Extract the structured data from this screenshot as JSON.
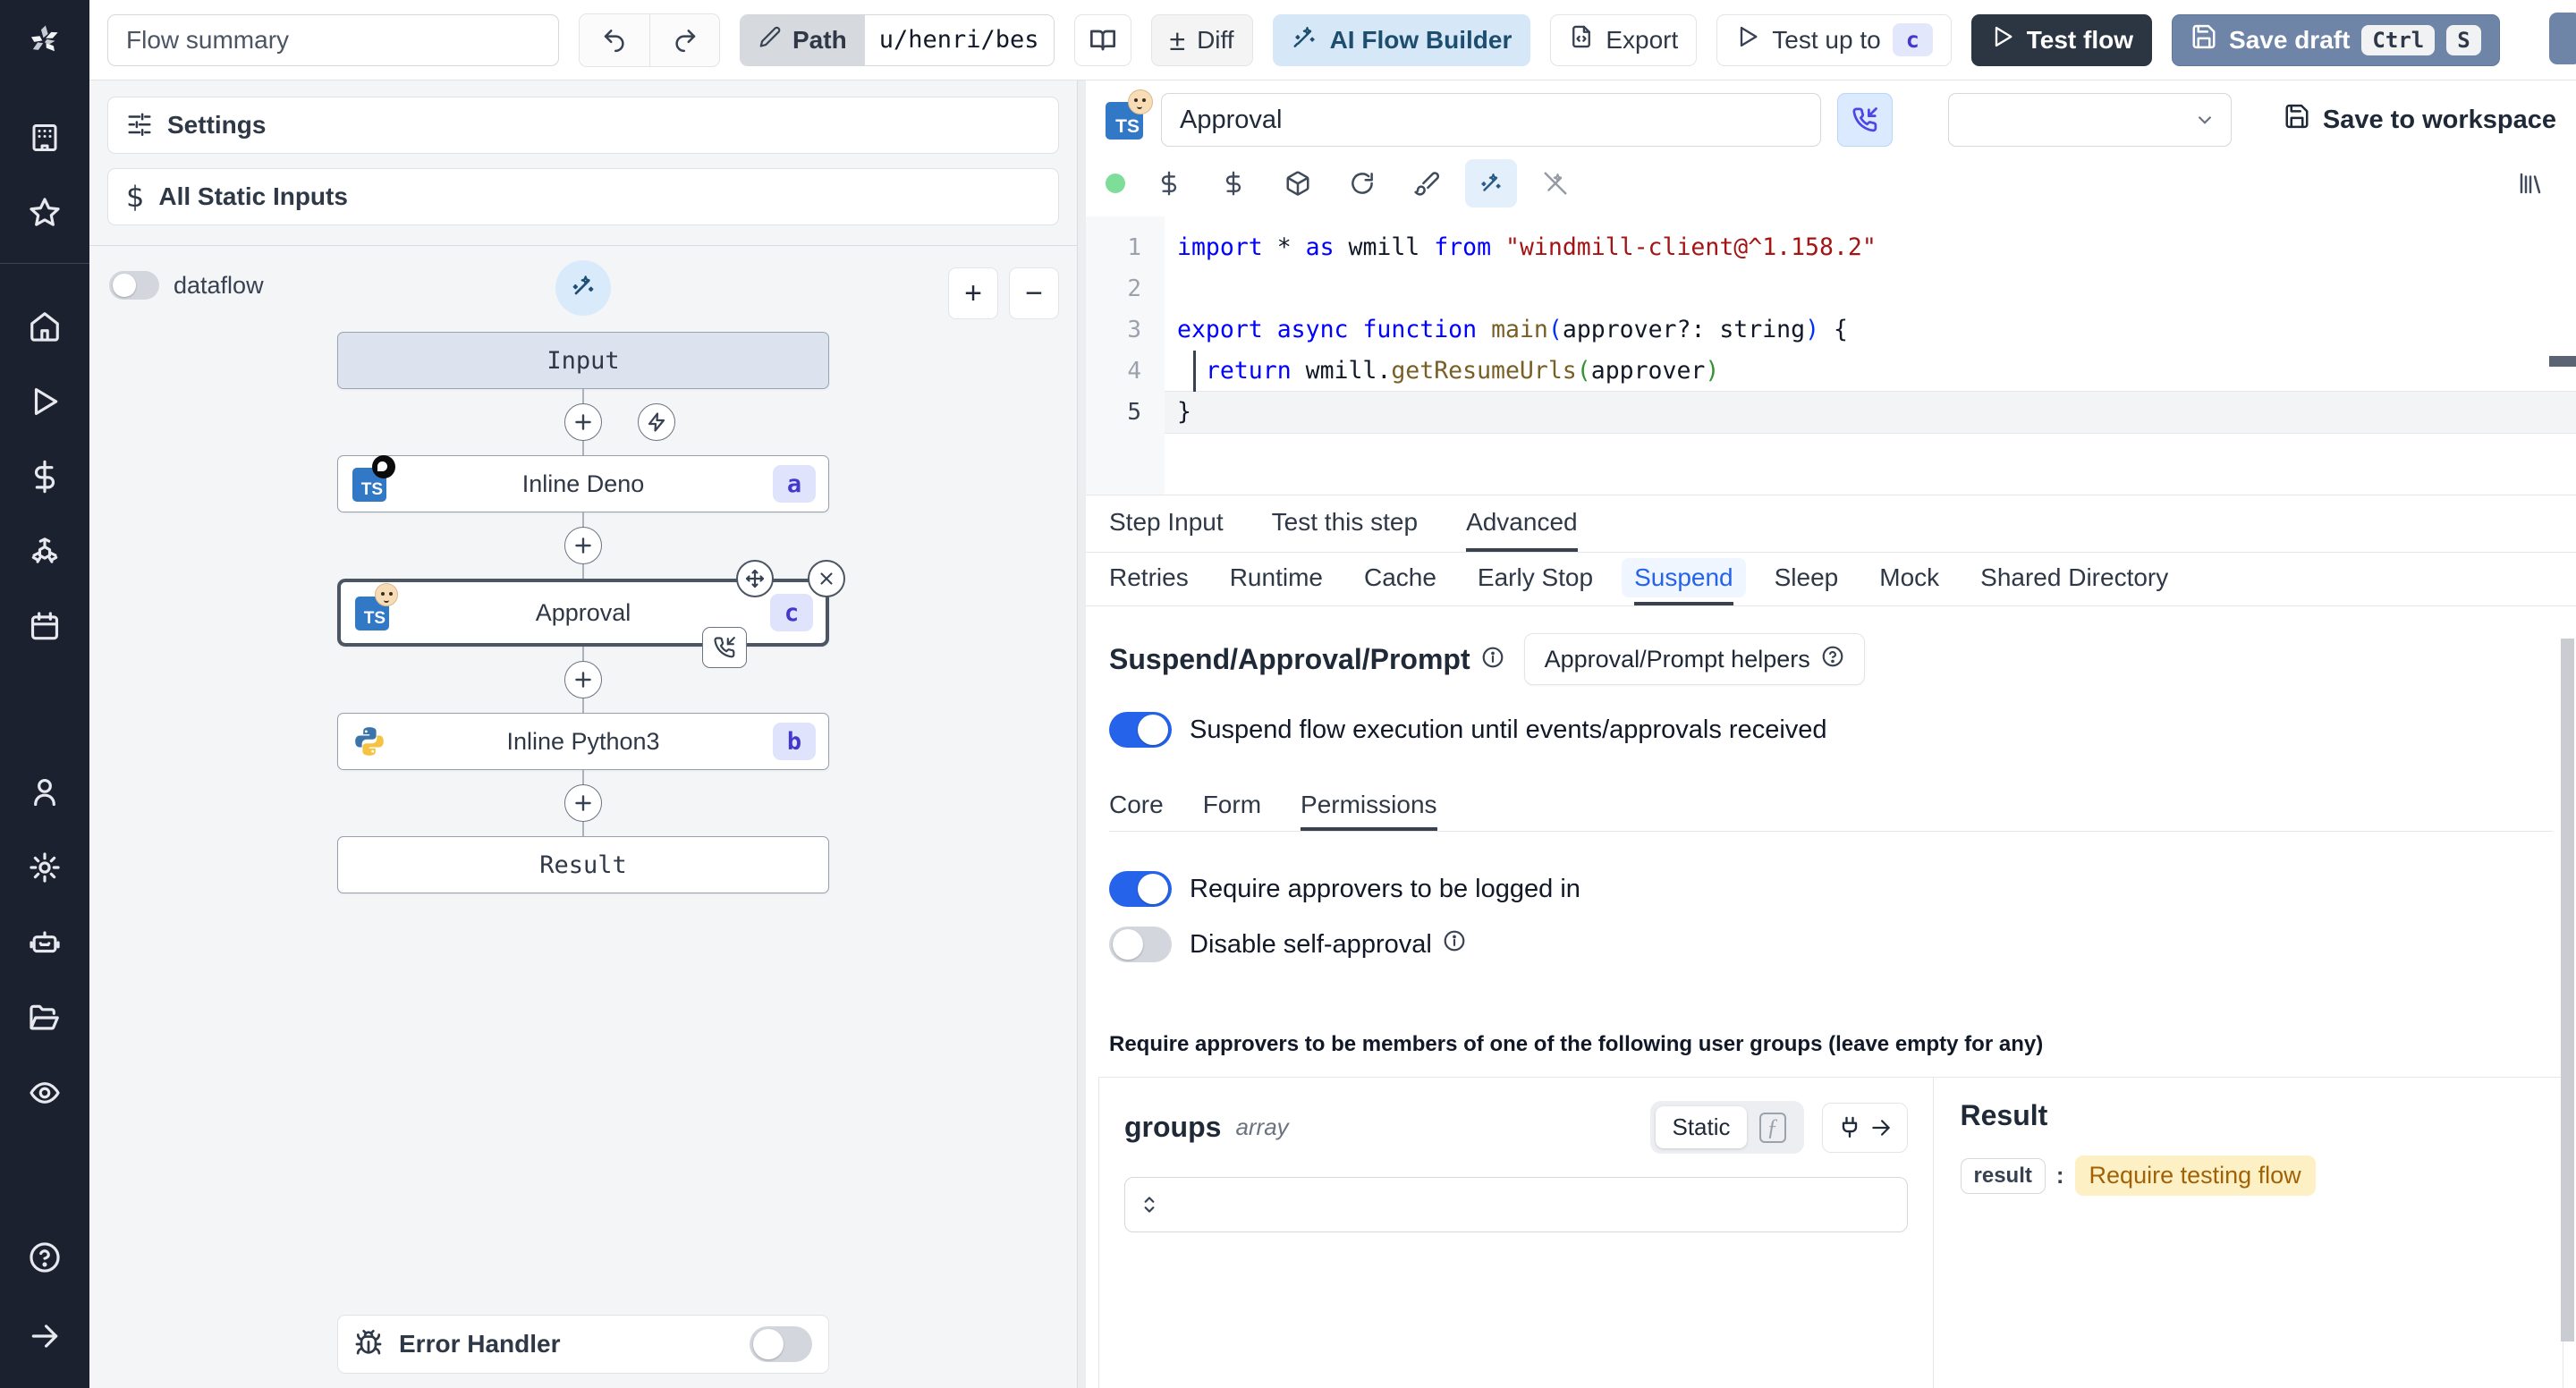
{
  "topbar": {
    "flow_summary_placeholder": "Flow summary",
    "path_label": "Path",
    "path_value": "u/henri/bes",
    "diff_label": "Diff",
    "diff_icon_glyph": "±",
    "ai_flow_builder_label": "AI Flow Builder",
    "export_label": "Export",
    "test_up_to_label": "Test up to",
    "test_up_to_badge": "c",
    "test_flow_label": "Test flow",
    "save_draft_label": "Save draft",
    "save_draft_kbd_1": "Ctrl",
    "save_draft_kbd_2": "S"
  },
  "flow_panel": {
    "settings_label": "Settings",
    "static_inputs_label": "All Static Inputs",
    "static_inputs_icon_glyph": "$",
    "dataflow_label": "dataflow",
    "zoom_in_glyph": "+",
    "zoom_out_glyph": "−",
    "error_handler_label": "Error Handler",
    "nodes": {
      "input_label": "Input",
      "deno_label": "Inline Deno",
      "deno_badge": "a",
      "approval_label": "Approval",
      "approval_badge": "c",
      "python_label": "Inline Python3",
      "python_badge": "b",
      "result_label": "Result"
    }
  },
  "step": {
    "name": "Approval",
    "save_to_workspace_label": "Save to workspace"
  },
  "editor": {
    "language_badge": "TS",
    "lines": [
      [
        {
          "t": "import",
          "c": "kw"
        },
        {
          "t": " * ",
          "c": "pl"
        },
        {
          "t": "as",
          "c": "kw"
        },
        {
          "t": " wmill ",
          "c": "pl"
        },
        {
          "t": "from",
          "c": "kw"
        },
        {
          "t": " ",
          "c": "pl"
        },
        {
          "t": "\"windmill-client@^1.158.2\"",
          "c": "str"
        }
      ],
      [],
      [
        {
          "t": "export",
          "c": "kw"
        },
        {
          "t": " ",
          "c": "pl"
        },
        {
          "t": "async",
          "c": "kw"
        },
        {
          "t": " ",
          "c": "pl"
        },
        {
          "t": "function",
          "c": "kw"
        },
        {
          "t": " ",
          "c": "pl"
        },
        {
          "t": "main",
          "c": "fn"
        },
        {
          "t": "(",
          "c": "pb"
        },
        {
          "t": "approver?: string",
          "c": "pl"
        },
        {
          "t": ")",
          "c": "pb"
        },
        {
          "t": " {",
          "c": "pl"
        }
      ],
      [
        {
          "t": "  ",
          "c": "pl"
        },
        {
          "t": "return",
          "c": "kw"
        },
        {
          "t": " wmill.",
          "c": "pl"
        },
        {
          "t": "getResumeUrls",
          "c": "fn"
        },
        {
          "t": "(",
          "c": "pg"
        },
        {
          "t": "approver",
          "c": "pl"
        },
        {
          "t": ")",
          "c": "pg"
        }
      ],
      [
        {
          "t": "}",
          "c": "pl"
        }
      ]
    ]
  },
  "tabs": {
    "items": [
      "Step Input",
      "Test this step",
      "Advanced"
    ]
  },
  "subtabs": {
    "items": [
      "Retries",
      "Runtime",
      "Cache",
      "Early Stop",
      "Suspend",
      "Sleep",
      "Mock",
      "Shared Directory"
    ]
  },
  "suspend": {
    "title": "Suspend/Approval/Prompt",
    "helpers_button_label": "Approval/Prompt helpers",
    "suspend_toggle_label": "Suspend flow execution until events/approvals received",
    "inner_tabs": [
      "Core",
      "Form",
      "Permissions"
    ],
    "require_login_label": "Require approvers to be logged in",
    "disable_self_approval_label": "Disable self-approval",
    "groups_note": "Require approvers to be members of one of the following user groups (leave empty for any)",
    "groups_field": {
      "name": "groups",
      "type": "array",
      "static_label": "Static",
      "function_icon_glyph": "ƒ"
    },
    "result_panel": {
      "title": "Result",
      "key": "result",
      "value": "Require testing flow"
    }
  },
  "colors": {
    "accent_blue": "#2563eb",
    "badge_bg": "#dfe4fc",
    "badge_text": "#4338ca",
    "ai_button_bg": "#d6e8f7",
    "ai_button_text": "#1d4e70",
    "test_flow_bg": "#2c3643",
    "save_draft_bg": "#6e85a8",
    "result_value_bg": "#fdf0c5",
    "result_value_text": "#a16207",
    "sidebar_bg": "#1c2130"
  }
}
